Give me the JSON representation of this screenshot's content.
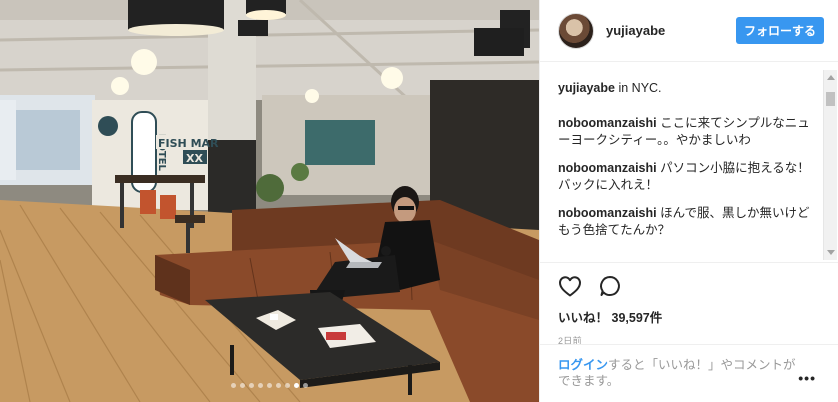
{
  "post": {
    "username": "yujiayabe",
    "follow_label": "フォローする",
    "caption_user": "yujiayabe",
    "caption_text": "in NYC."
  },
  "comments": [
    {
      "user": "noboomanzaishi",
      "text": "ここに来てシンプルなニューヨークシティー。。やかましいわ"
    },
    {
      "user": "noboomanzaishi",
      "text": "パソコン小脇に抱えるな！バックに入れえ！"
    },
    {
      "user": "noboomanzaishi",
      "text": "ほんで服、黒しか無いけどもう色捨てたんか？"
    }
  ],
  "stats": {
    "likes_label": "いいね！",
    "likes_count": "39,597件",
    "time_ago": "2日前"
  },
  "footer": {
    "login_label": "ログイン",
    "rest_text": "すると「いいね！」やコメントができます。",
    "more_label": "•••"
  },
  "photo": {
    "sign_hotel": "HOTEL",
    "sign_fish": "FISH MAR",
    "sign_xx": "XX",
    "carousel_count": 9,
    "carousel_active_index": 7
  },
  "icons": [
    "heart-icon",
    "comment-icon",
    "more-options-icon"
  ],
  "colors": {
    "follow_button": "#3897f0",
    "link": "#3897f0",
    "muted": "#999999"
  }
}
